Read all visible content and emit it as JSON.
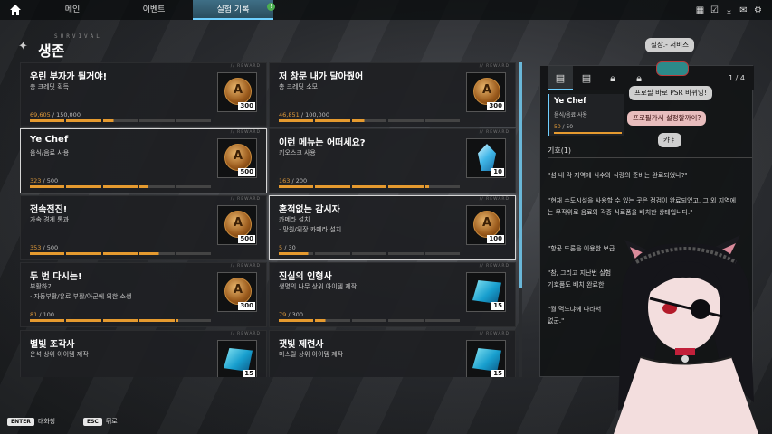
{
  "top_tabs": [
    {
      "label": "메인"
    },
    {
      "label": "이벤트"
    },
    {
      "label": "실험 기록",
      "badge": "!"
    }
  ],
  "top_icons": [
    "calendar-icon",
    "calendar-check-icon",
    "download-icon",
    "mail-icon",
    "settings-icon"
  ],
  "section": {
    "title_en": "SURVIVAL",
    "title": "생존"
  },
  "reward_tag": "// REWARD",
  "cards": [
    {
      "title": "우린 부자가 될거야!",
      "desc": "총 크레딧 획득",
      "desc2": "",
      "current": "69,605",
      "total": "150,000",
      "reward_type": "coin",
      "amount": "300",
      "fraction": 0.46
    },
    {
      "title": "저 창문 내가 달아줬어",
      "desc": "총 크레딧 소모",
      "desc2": "",
      "current": "46,851",
      "total": "100,000",
      "reward_type": "coin",
      "amount": "300",
      "fraction": 0.47
    },
    {
      "title": "Ye Chef",
      "desc": "음식/음료 사용",
      "desc2": "",
      "current": "323",
      "total": "500",
      "reward_type": "coin",
      "amount": "500",
      "fraction": 0.65
    },
    {
      "title": "이런 메뉴는 어떠세요?",
      "desc": "키오스크 사용",
      "desc2": "",
      "current": "163",
      "total": "200",
      "reward_type": "crystal",
      "amount": "10",
      "fraction": 0.82
    },
    {
      "title": "전속전진!",
      "desc": "가속 경계 통과",
      "desc2": "",
      "current": "353",
      "total": "500",
      "reward_type": "coin",
      "amount": "500",
      "fraction": 0.71
    },
    {
      "title": "혼적없는 감시자",
      "desc": "카메라 설치",
      "desc2": "· 망원/위장 카메라 설치",
      "current": "5",
      "total": "30",
      "reward_type": "coin",
      "amount": "100",
      "fraction": 0.17
    },
    {
      "title": "두 번 다시는!",
      "desc": "부활하기",
      "desc2": "· 자동부활/유료 부활/아군에 의한 소생",
      "current": "81",
      "total": "100",
      "reward_type": "coin",
      "amount": "300",
      "fraction": 0.81
    },
    {
      "title": "진실의 인형사",
      "desc": "생명의 나무 상위 아이템 제작",
      "desc2": "",
      "current": "79",
      "total": "300",
      "reward_type": "cube",
      "amount": "15",
      "fraction": 0.26
    },
    {
      "title": "별빛 조각사",
      "desc": "운석 상위 아이템 제작",
      "desc2": "",
      "current": "",
      "total": "",
      "reward_type": "cube",
      "amount": "15",
      "fraction": 0
    },
    {
      "title": "잿빛 제련사",
      "desc": "미스릴 상위 아이템 제작",
      "desc2": "",
      "current": "",
      "total": "",
      "reward_type": "cube",
      "amount": "15",
      "fraction": 0
    }
  ],
  "panel": {
    "tabs": [
      "document-icon",
      "document-icon",
      "lock-icon",
      "lock-icon"
    ],
    "page": "1 / 4",
    "entry": {
      "title": "Ye Chef",
      "desc": "음식/음료 사용",
      "current": "50",
      "total": "50"
    },
    "heading": "기호(1)",
    "paragraphs": [
      "\"섬 내 각 지역에 식수와 식량의 준비는 완료되었나?\"",
      "\"현재 수도시설을 사용할 수 있는 곳은 점검이 완료되었고, 그 외 지역에는 무작위로 음료와 각종 식료품을 배치한 상태입니다.\"",
      "\"항공 드론을 이용한 보급",
      "\"참, 그리고 지난번 실험",
      "기호품도 배치 완료한",
      "\"뭘 먹느냐에 따라서",
      "없군.\""
    ]
  },
  "chat": {
    "msg1": "실장.- 서비스",
    "msg2": "프로필 바로 PSR 바뀌잉!",
    "msg3": "프로필가서 설정할까이?",
    "msg4": "캬ㅑ"
  },
  "footer": [
    {
      "key": "ENTER",
      "label": "대화창"
    },
    {
      "key": "ESC",
      "label": "뒤로"
    }
  ]
}
